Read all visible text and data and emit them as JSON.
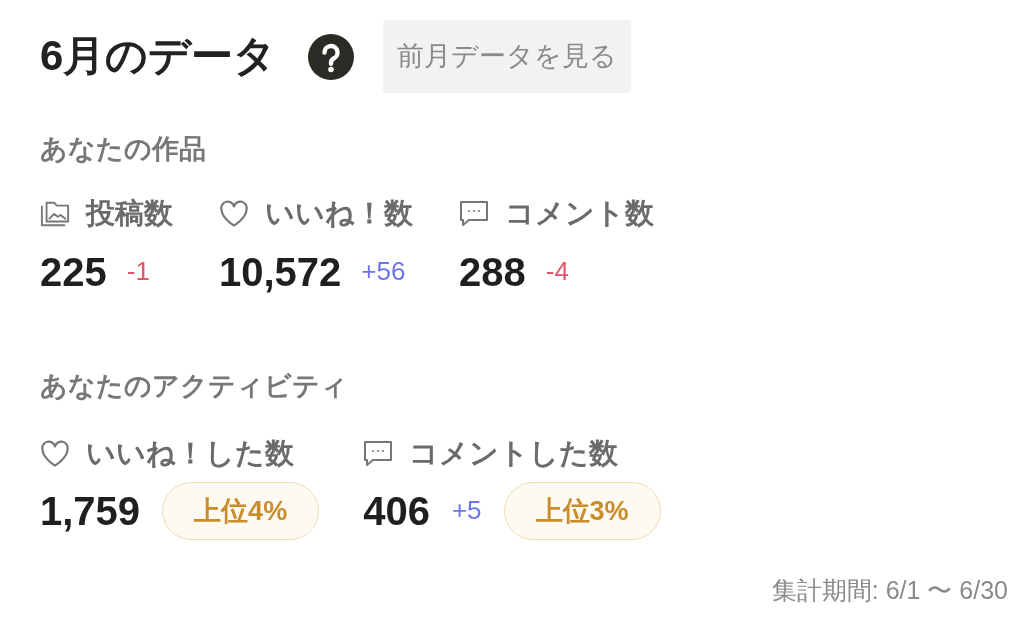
{
  "title": "6月のデータ",
  "previous_month_button": "前月データを見る",
  "sections": [
    {
      "heading": "あなたの作品",
      "stats": [
        {
          "kind": "posts",
          "label": "投稿数",
          "value": "225",
          "change": {
            "text": "-1",
            "color": "#e0566a"
          }
        },
        {
          "kind": "likes",
          "label": "いいね！数",
          "value": "10,572",
          "change": {
            "text": "+56",
            "color": "#6c74ef"
          }
        },
        {
          "kind": "comments",
          "label": "コメント数",
          "value": "288",
          "change": {
            "text": "-4",
            "color": "#e0566a"
          }
        }
      ]
    },
    {
      "heading": "あなたのアクティビティ",
      "stats": [
        {
          "kind": "likes",
          "label": "いいね！した数",
          "value": "1,759",
          "rank": "上位4%"
        },
        {
          "kind": "comments",
          "label": "コメントした数",
          "value": "406",
          "change": {
            "text": "+5",
            "color": "#6c74ef"
          },
          "rank": "上位3%"
        }
      ]
    }
  ],
  "period": "集計期間: 6/1 〜 6/30"
}
